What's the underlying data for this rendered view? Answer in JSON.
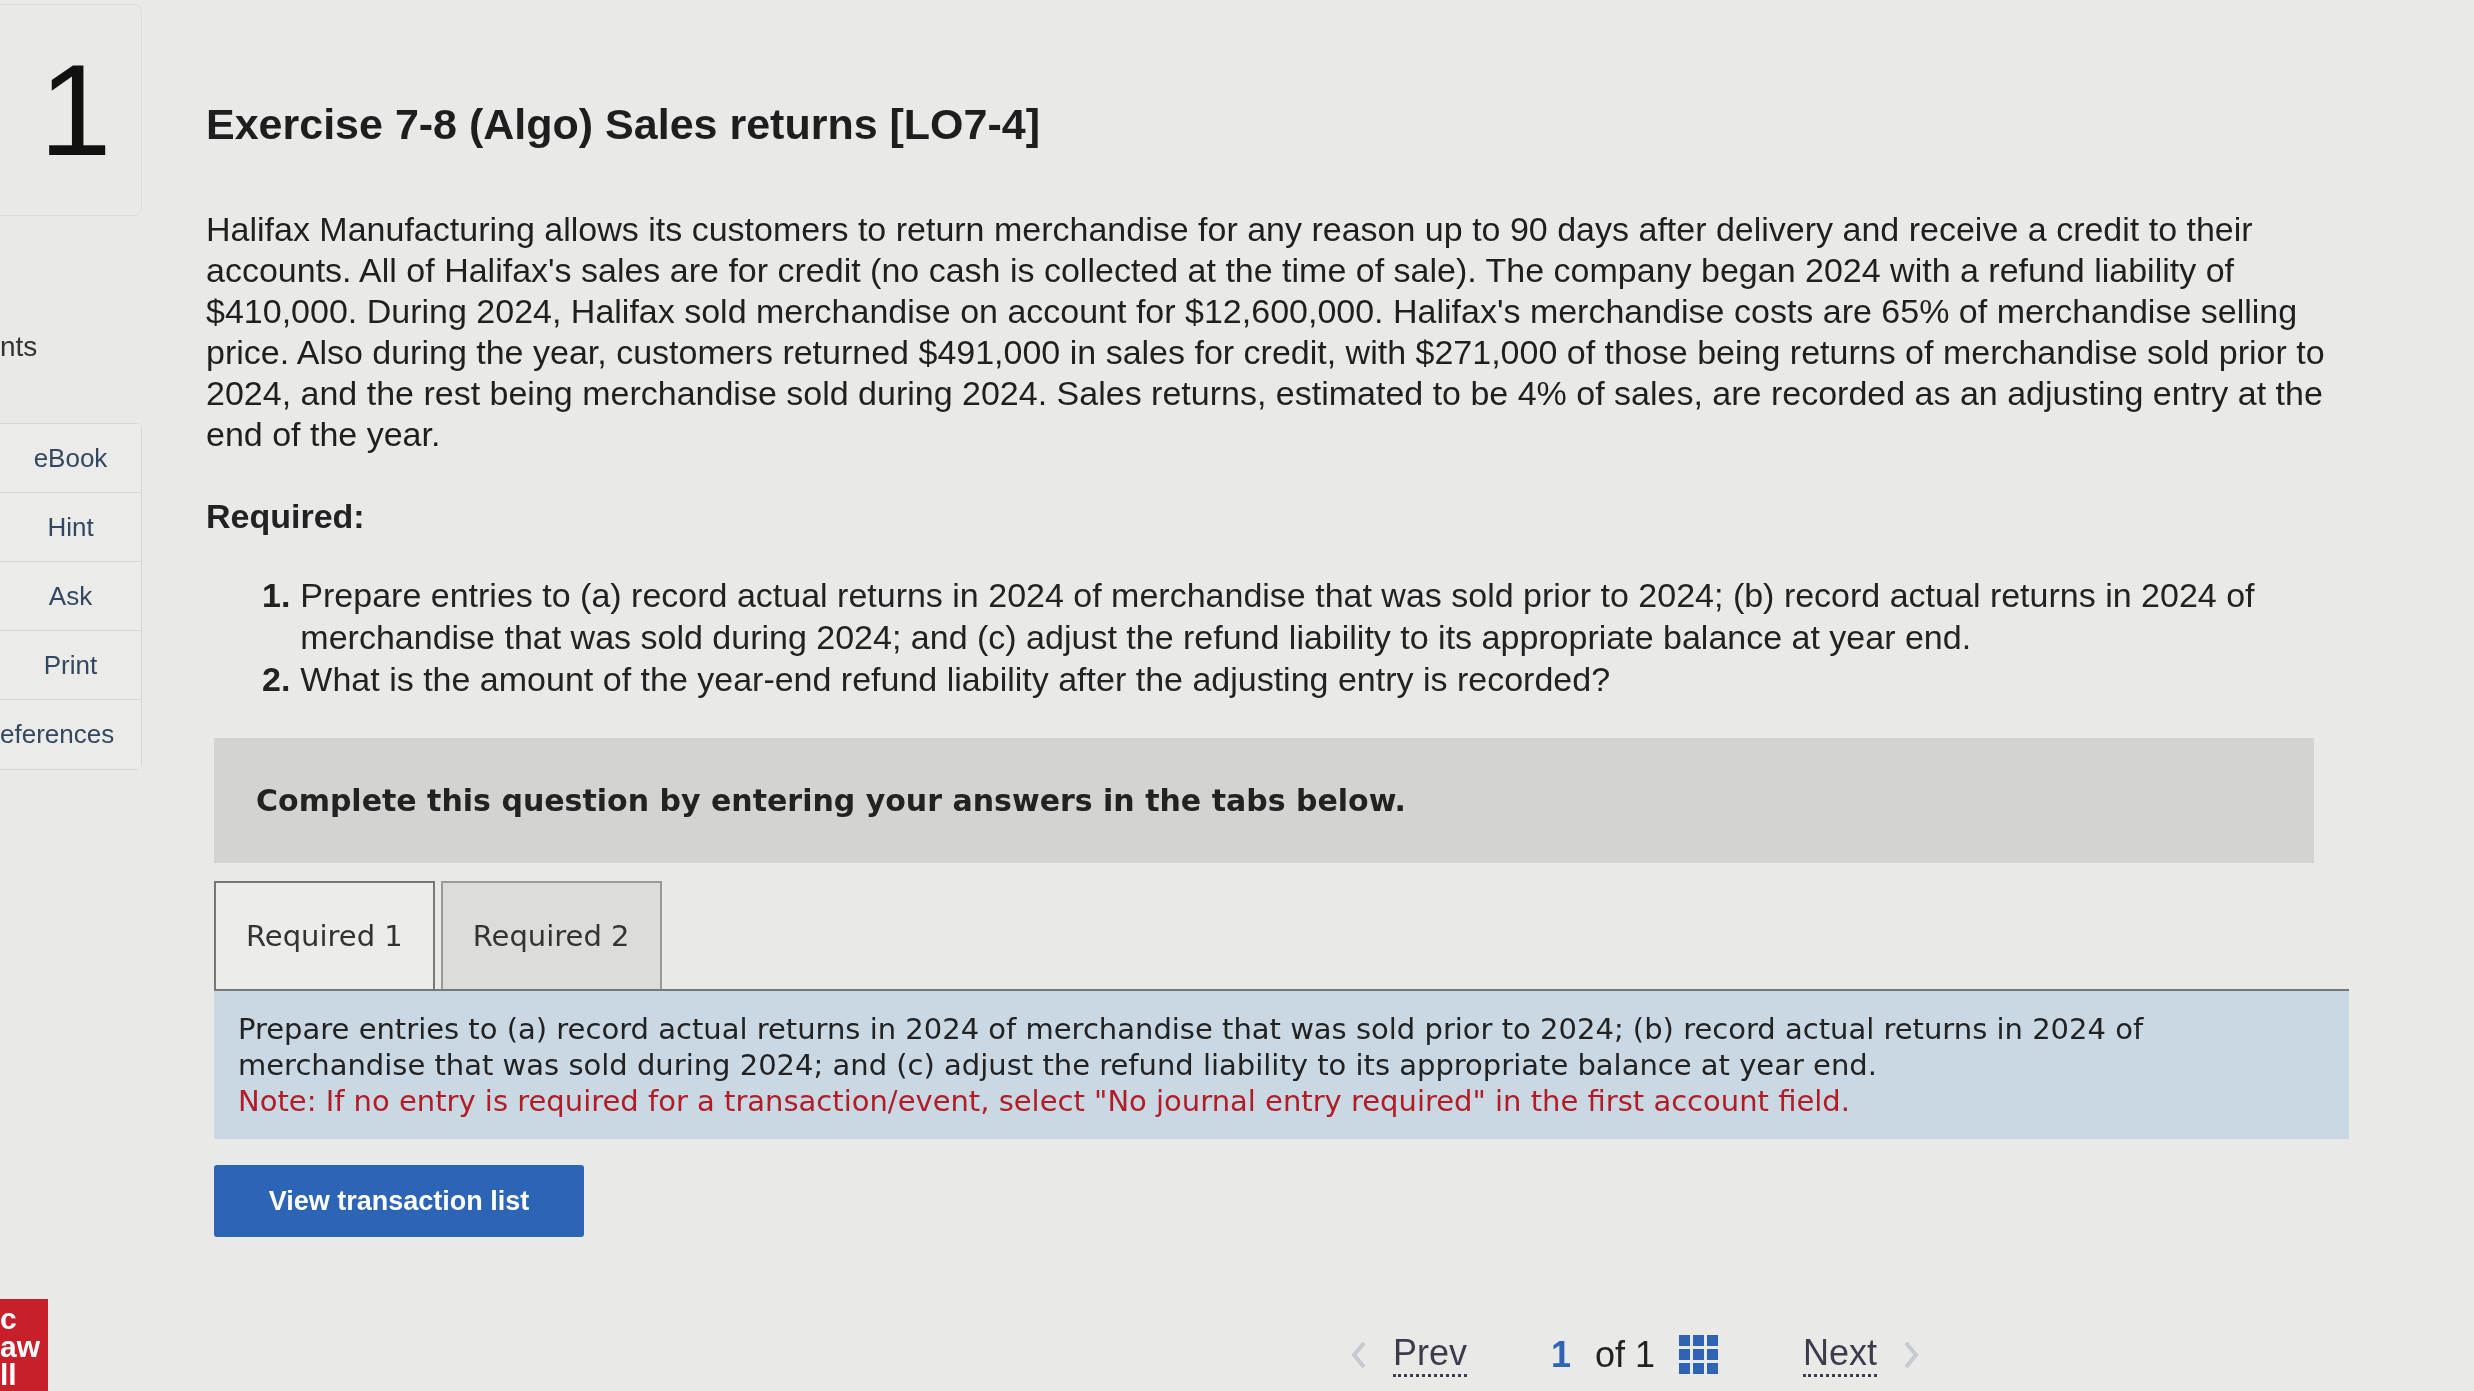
{
  "sidebar": {
    "question_number": "1",
    "points_label": "nts",
    "tools": [
      "eBook",
      "Hint",
      "Ask",
      "Print",
      "eferences"
    ],
    "logo_lines": [
      "c",
      "aw",
      "ll"
    ]
  },
  "title": "Exercise 7-8 (Algo) Sales returns [LO7-4]",
  "problem": "Halifax Manufacturing allows its customers to return merchandise for any reason up to 90 days after delivery and receive a credit to their accounts. All of Halifax's sales are for credit (no cash is collected at the time of sale). The company began 2024 with a refund liability of $410,000. During 2024, Halifax sold merchandise on account for $12,600,000. Halifax's merchandise costs are 65% of merchandise selling price. Also during the year, customers returned $491,000 in sales for credit, with $271,000 of those being returns of merchandise sold prior to 2024, and the rest being merchandise sold during 2024. Sales returns, estimated to be 4% of sales, are recorded as an adjusting entry at the end of the year.",
  "required_heading": "Required:",
  "requirements": [
    {
      "number": "1.",
      "text": "Prepare entries to (a) record actual returns in 2024 of merchandise that was sold prior to 2024; (b) record actual returns in 2024 of merchandise that was sold during 2024; and (c) adjust the refund liability to its appropriate balance at year end."
    },
    {
      "number": "2.",
      "text": "What is the amount of the year-end refund liability after the adjusting entry is recorded?"
    }
  ],
  "banner": "Complete this question by entering your answers in the tabs below.",
  "tabs": [
    {
      "label": "Required 1",
      "selected": true
    },
    {
      "label": "Required 2",
      "selected": false
    }
  ],
  "instructions": "Prepare entries to (a) record actual returns in 2024 of merchandise that was sold prior to 2024; (b) record actual returns in 2024 of merchandise that was sold during 2024; and (c) adjust the refund liability to its appropriate balance at year end.",
  "note": "Note: If no entry is required for a transaction/event, select \"No journal entry required\" in the first account field.",
  "view_button": "View transaction list",
  "pager": {
    "prev": "Prev",
    "current": "1",
    "of": "of 1",
    "next": "Next"
  }
}
